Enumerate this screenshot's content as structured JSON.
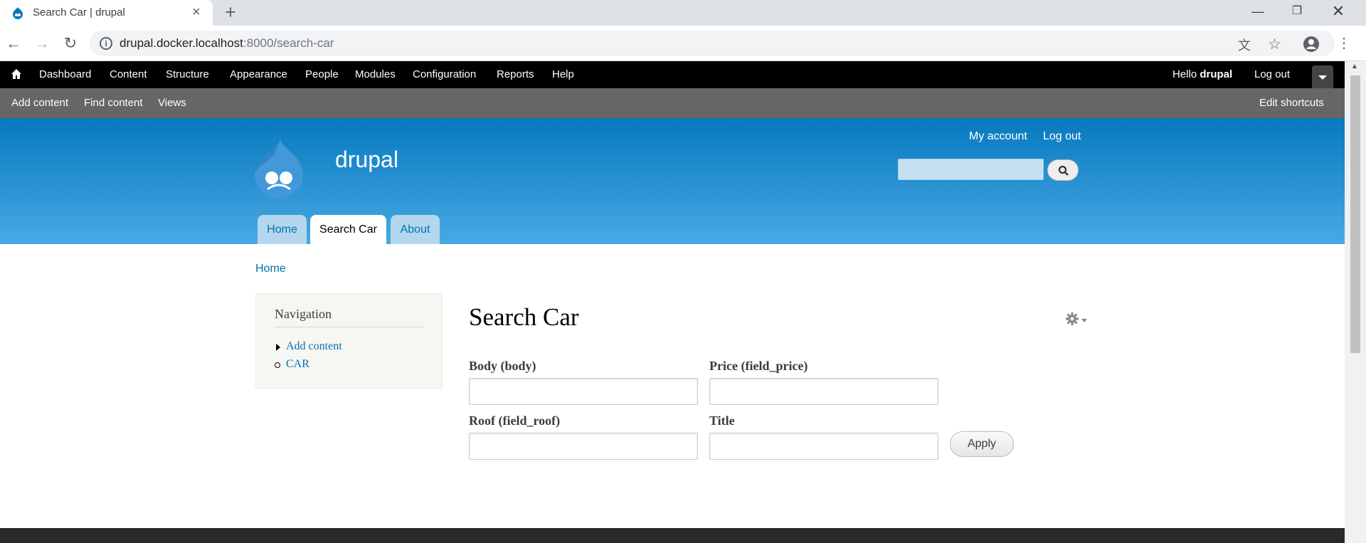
{
  "browser": {
    "tab_title": "Search Car | drupal",
    "new_tab": "+",
    "url_host": "drupal.docker.localhost",
    "url_rest": ":8000/search-car"
  },
  "admin_toolbar": {
    "items": [
      "Dashboard",
      "Content",
      "Structure",
      "Appearance",
      "People",
      "Modules",
      "Configuration",
      "Reports",
      "Help"
    ],
    "hello_prefix": "Hello ",
    "hello_user": "drupal",
    "logout": "Log out"
  },
  "shortcuts": {
    "items": [
      "Add content",
      "Find content",
      "Views"
    ],
    "edit": "Edit shortcuts"
  },
  "header": {
    "site_name": "drupal",
    "my_account": "My account",
    "logout": "Log out",
    "tabs": [
      "Home",
      "Search Car",
      "About"
    ]
  },
  "breadcrumb": "Home",
  "sidebar": {
    "title": "Navigation",
    "links": [
      "Add content",
      "CAR"
    ]
  },
  "main": {
    "title": "Search Car",
    "fields": {
      "body": "Body (body)",
      "price": "Price (field_price)",
      "roof": "Roof (field_roof)",
      "title": "Title"
    },
    "apply": "Apply"
  },
  "colors": {
    "header_top": "#0779bf",
    "header_bottom": "#48a9e4",
    "link": "#0071b3"
  }
}
